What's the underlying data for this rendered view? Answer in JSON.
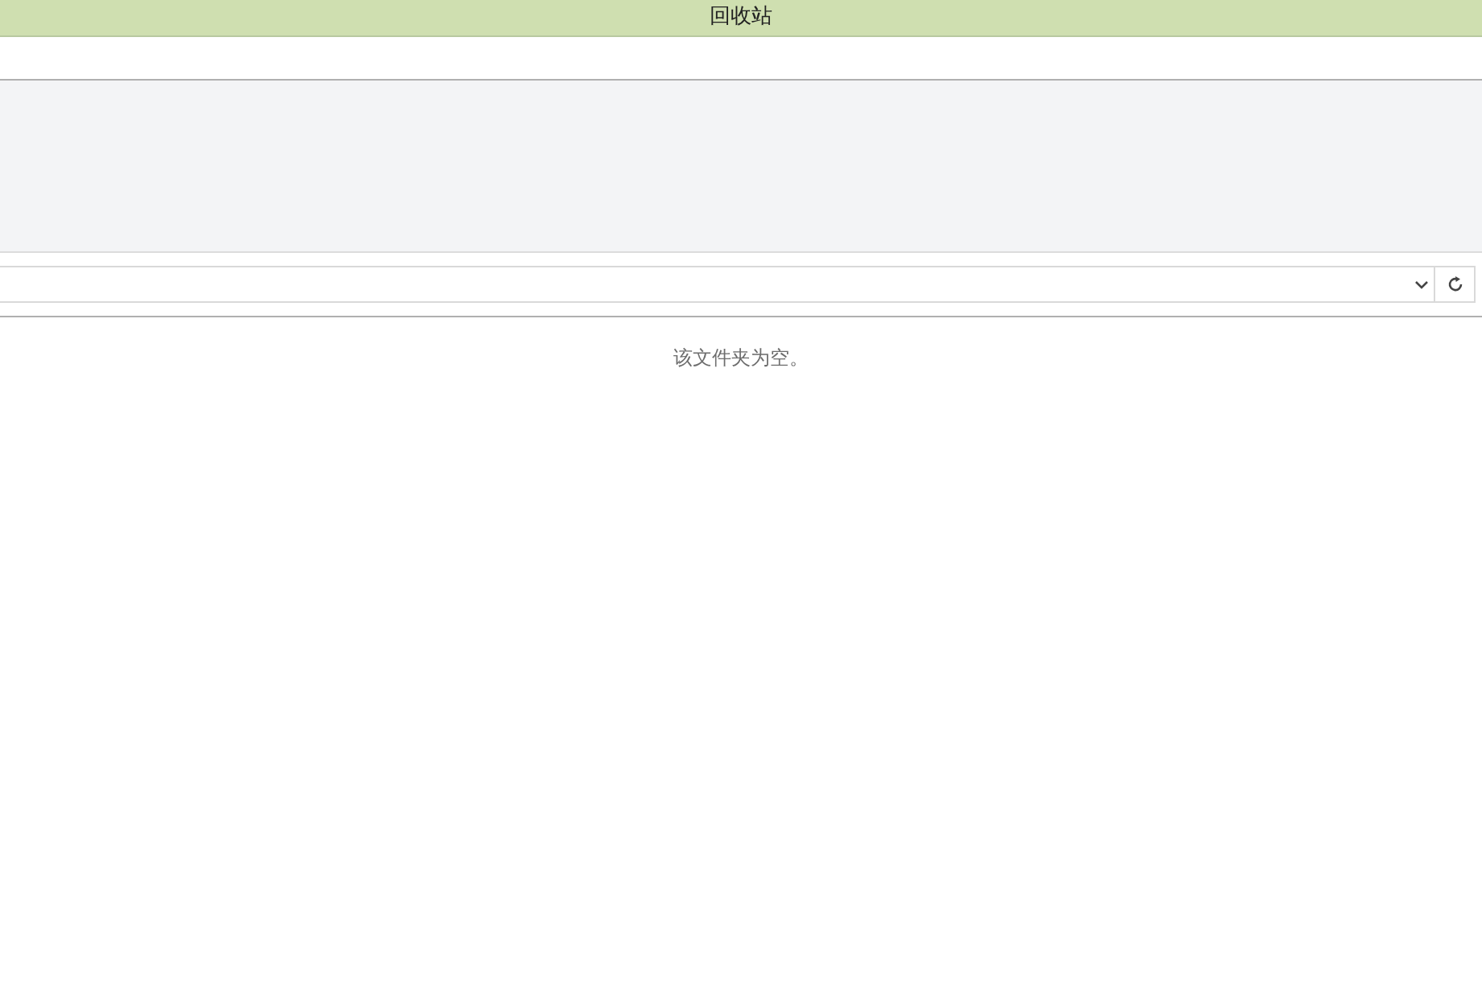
{
  "window": {
    "title": "回收站"
  },
  "content": {
    "empty_message": "该文件夹为空。"
  }
}
